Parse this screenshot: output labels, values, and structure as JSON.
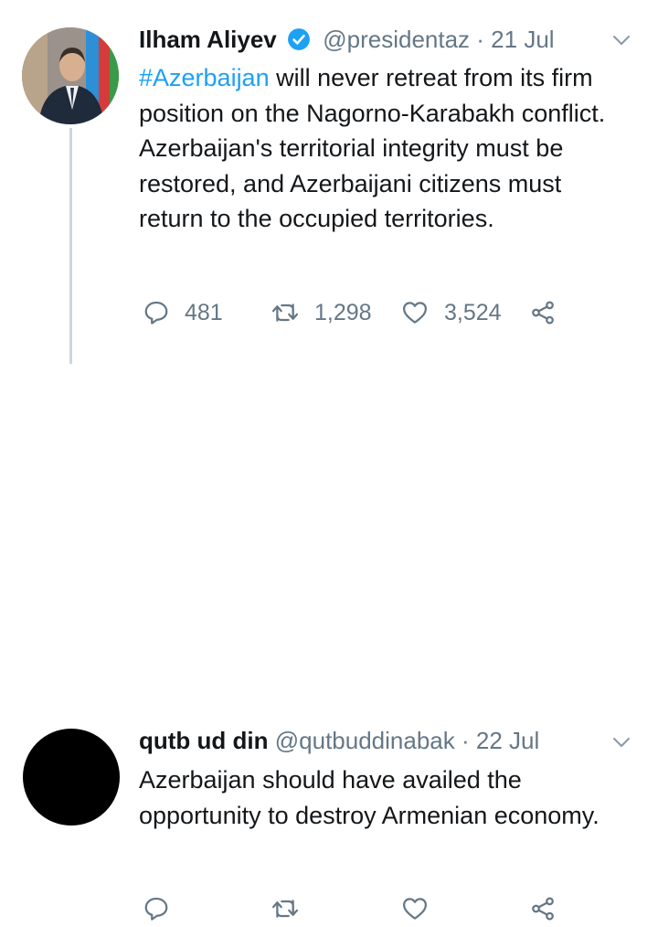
{
  "tweets": [
    {
      "name": "Ilham Aliyev",
      "verified": true,
      "handle": "@presidentaz",
      "separator": " · ",
      "date": "21 Jul",
      "hashtag": "#Azerbaijan",
      "text": " will never retreat from its firm position on the Nagorno-Karabakh conflict. Azerbaijan's territorial integrity must be restored, and Azerbaijani citizens must return to the occupied territories.",
      "replies": "481",
      "retweets": "1,298",
      "likes": "3,524"
    },
    {
      "name": "qutb ud din",
      "handle": "@qutbuddinabak",
      "separator": " · ",
      "date": "22 Jul",
      "text": "Azerbaijan should have availed the opportunity to destroy Armenian economy.",
      "replies": "",
      "retweets": "",
      "likes": ""
    }
  ],
  "colors": {
    "text": "#14171a",
    "secondary": "#657786",
    "accent": "#1da1f2",
    "thread_line": "#ccd6dd"
  },
  "icons": [
    "verified-badge-icon",
    "chevron-down-icon",
    "reply-icon",
    "retweet-icon",
    "like-icon",
    "share-icon"
  ]
}
